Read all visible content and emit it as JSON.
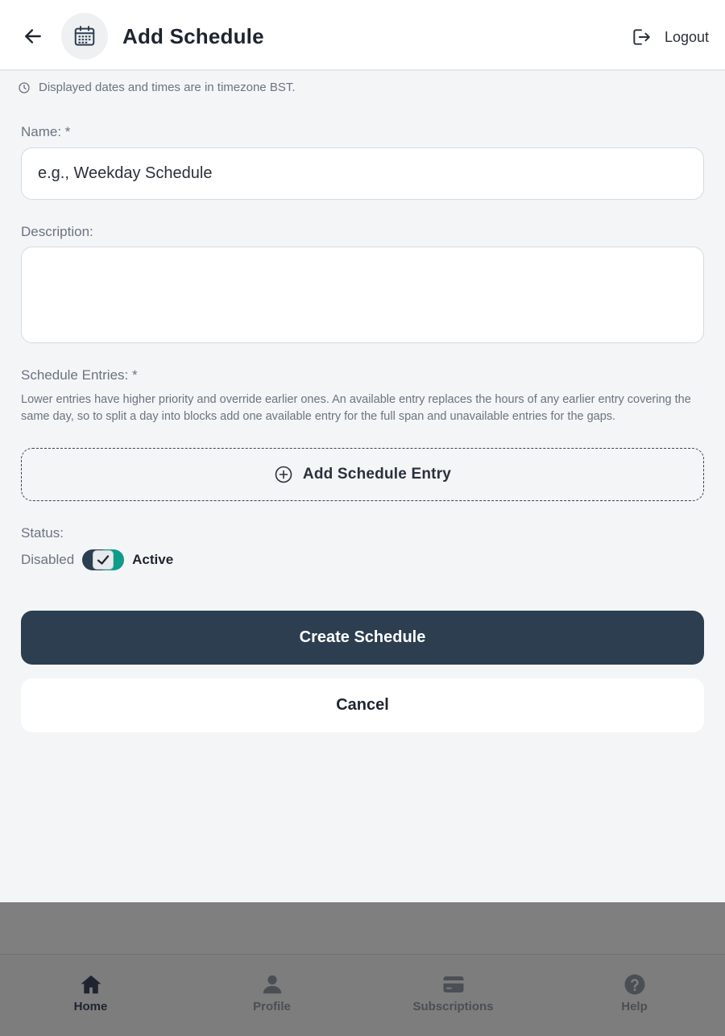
{
  "header": {
    "title": "Add Schedule",
    "logout_label": "Logout",
    "icons": {
      "back": "arrow-left-icon",
      "app": "calendar-icon",
      "logout": "logout-icon"
    }
  },
  "timezone_note": "Displayed dates and times are in timezone BST.",
  "form": {
    "name": {
      "label": "Name: *",
      "placeholder": "e.g., Weekday Schedule",
      "value": ""
    },
    "description": {
      "label": "Description:",
      "value": ""
    },
    "entries": {
      "label": "Schedule Entries: *",
      "help": "Lower entries have higher priority and override earlier ones. An available entry replaces the hours of any earlier entry covering the same day, so to split a day into blocks add one available entry for the full span and unavailable entries for the gaps.",
      "add_label": "Add Schedule Entry"
    },
    "status": {
      "label": "Status:",
      "off_label": "Disabled",
      "on_label": "Active",
      "checked": true
    },
    "submit_label": "Create Schedule",
    "cancel_label": "Cancel"
  },
  "nav": {
    "items": [
      {
        "label": "Home",
        "icon": "home-icon",
        "active": true
      },
      {
        "label": "Profile",
        "icon": "user-icon",
        "active": false
      },
      {
        "label": "Subscriptions",
        "icon": "credit-card-icon",
        "active": false
      },
      {
        "label": "Help",
        "icon": "help-circle-icon",
        "active": false
      }
    ]
  },
  "colors": {
    "primary": "#2c3e50",
    "toggle_on": "#0e9b8a",
    "background": "#f3f5f7",
    "overlay": "#7f7f7f"
  }
}
